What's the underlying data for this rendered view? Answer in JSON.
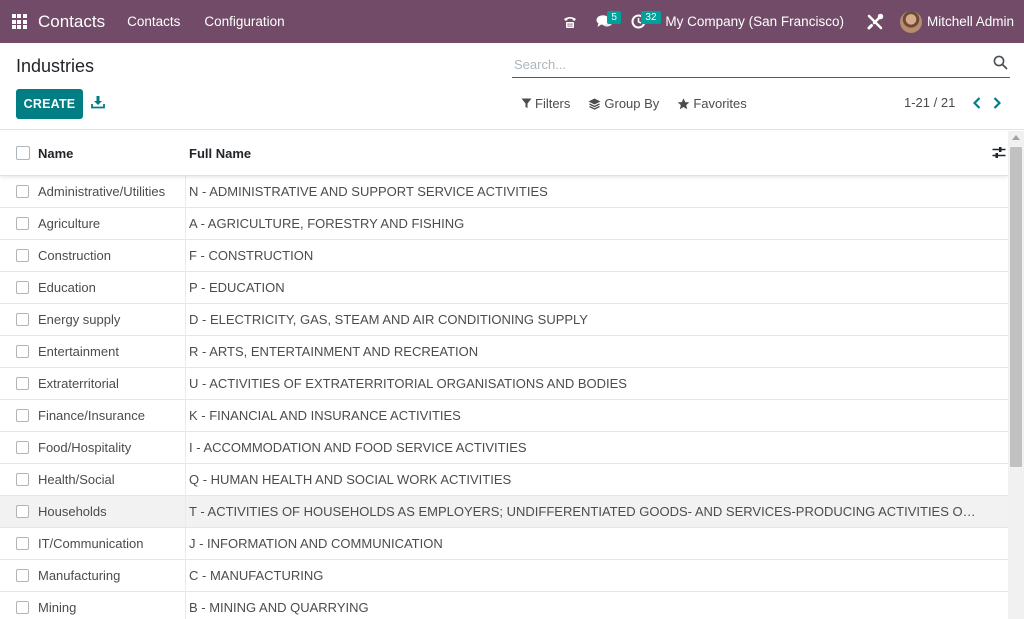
{
  "navbar": {
    "app_name": "Contacts",
    "menu": [
      "Contacts",
      "Configuration"
    ],
    "messages_count": "5",
    "activities_count": "32",
    "company": "My Company (San Francisco)",
    "user_name": "Mitchell Admin",
    "bg_color": "#714b67",
    "icons": [
      "apps-grid-icon",
      "phone-icon",
      "chat-icon",
      "clock-icon",
      "debug-tools-icon"
    ]
  },
  "control_panel": {
    "title": "Industries",
    "search_placeholder": "Search...",
    "create_label": "CREATE",
    "filters_label": "Filters",
    "group_by_label": "Group By",
    "favorites_label": "Favorites",
    "pager_value": "1-21 / 21",
    "accent": "#017e84"
  },
  "table": {
    "columns": [
      "Name",
      "Full Name"
    ],
    "rows": [
      {
        "name": "Administrative/Utilities",
        "full_name": "N - ADMINISTRATIVE AND SUPPORT SERVICE ACTIVITIES"
      },
      {
        "name": "Agriculture",
        "full_name": "A - AGRICULTURE, FORESTRY AND FISHING"
      },
      {
        "name": "Construction",
        "full_name": "F - CONSTRUCTION"
      },
      {
        "name": "Education",
        "full_name": "P - EDUCATION"
      },
      {
        "name": "Energy supply",
        "full_name": "D - ELECTRICITY, GAS, STEAM AND AIR CONDITIONING SUPPLY"
      },
      {
        "name": "Entertainment",
        "full_name": "R - ARTS, ENTERTAINMENT AND RECREATION"
      },
      {
        "name": "Extraterritorial",
        "full_name": "U - ACTIVITIES OF EXTRATERRITORIAL ORGANISATIONS AND BODIES"
      },
      {
        "name": "Finance/Insurance",
        "full_name": "K - FINANCIAL AND INSURANCE ACTIVITIES"
      },
      {
        "name": "Food/Hospitality",
        "full_name": "I - ACCOMMODATION AND FOOD SERVICE ACTIVITIES"
      },
      {
        "name": "Health/Social",
        "full_name": "Q - HUMAN HEALTH AND SOCIAL WORK ACTIVITIES"
      },
      {
        "name": "Households",
        "full_name": "T - ACTIVITIES OF HOUSEHOLDS AS EMPLOYERS; UNDIFFERENTIATED GOODS- AND SERVICES-PRODUCING ACTIVITIES OF HOUSEHOLDS FOR OWN USE"
      },
      {
        "name": "IT/Communication",
        "full_name": "J - INFORMATION AND COMMUNICATION"
      },
      {
        "name": "Manufacturing",
        "full_name": "C - MANUFACTURING"
      },
      {
        "name": "Mining",
        "full_name": "B - MINING AND QUARRYING"
      }
    ]
  }
}
